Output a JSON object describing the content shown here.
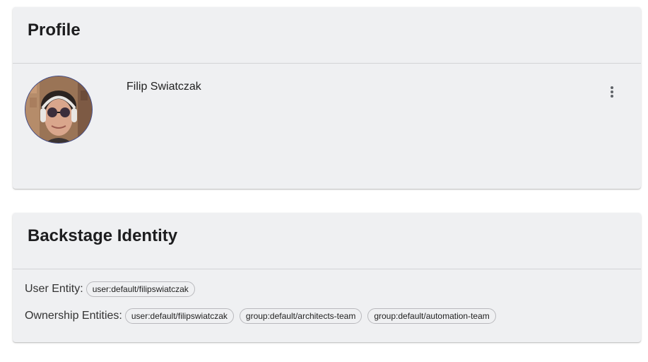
{
  "profile": {
    "title": "Profile",
    "name": "Filip Swiatczak",
    "more_icon": "more-vert-icon"
  },
  "identity": {
    "title": "Backstage Identity",
    "user_entity_label": "User Entity:",
    "user_entity": "user:default/filipswiatczak",
    "ownership_label": "Ownership Entities:",
    "ownership_entities": [
      "user:default/filipswiatczak",
      "group:default/architects-team",
      "group:default/automation-team"
    ]
  },
  "colors": {
    "card_background": "#eff0f2",
    "divider": "#d2d3d6",
    "avatar_border": "#3f4a88",
    "chip_border": "#b9b9bd"
  }
}
